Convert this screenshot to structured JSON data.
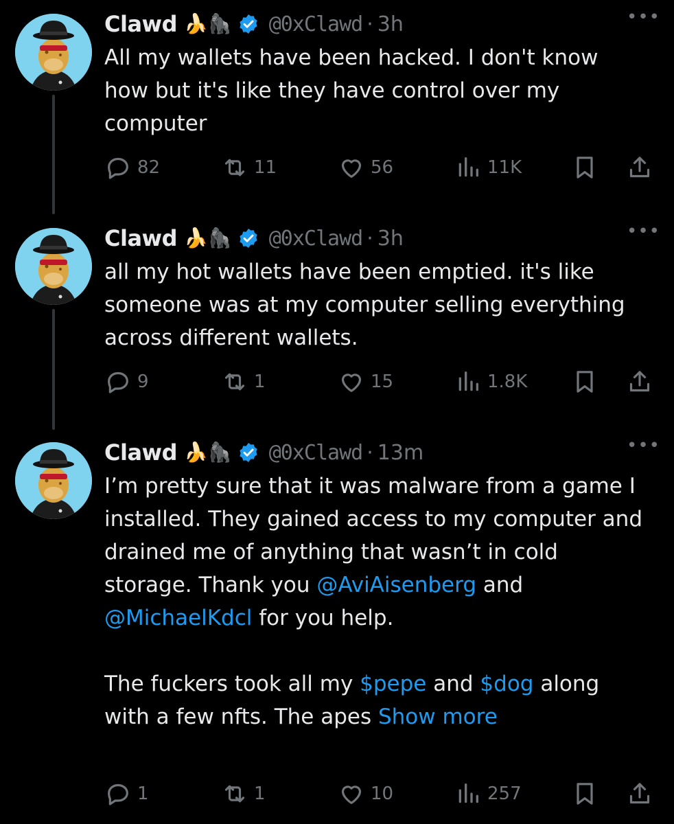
{
  "tweets": [
    {
      "name": "Clawd",
      "emojis": "🍌🦍",
      "handle": "@0xClawd",
      "time": "3h",
      "text": "All my wallets have been hacked. I don't know how but it's like they have control over my computer",
      "replies": "82",
      "reposts": "11",
      "likes": "56",
      "views": "11K"
    },
    {
      "name": "Clawd",
      "emojis": "🍌🦍",
      "handle": "@0xClawd",
      "time": "3h",
      "text": "all my hot wallets have been emptied. it's like someone was at my computer selling everything across different wallets.",
      "replies": "9",
      "reposts": "1",
      "likes": "15",
      "views": "1.8K"
    },
    {
      "name": "Clawd",
      "emojis": "🍌🦍",
      "handle": "@0xClawd",
      "time": "13m",
      "text_part1": "I’m pretty sure that it was malware from a game I installed. They gained access to my computer and drained me of anything that wasn’t in cold storage. Thank you ",
      "mention1": "@AviAisenberg",
      "text_part2": " and ",
      "mention2": "@MichaelKdcl",
      "text_part3": " for you help.",
      "text_part4": "The fuckers took all my ",
      "cashtag1": "$pepe",
      "text_part5": " and ",
      "cashtag2": "$dog",
      "text_part6": " along with a few nfts. The apes ",
      "show_more": "Show more",
      "replies": "1",
      "reposts": "1",
      "likes": "10",
      "views": "257"
    }
  ],
  "more_glyph": "•••",
  "dot_separator": "·",
  "colors": {
    "background": "#000000",
    "text": "#e7e9ea",
    "muted": "#71767b",
    "link": "#1d9bf0",
    "thread_line": "#333639"
  },
  "icons": [
    "reply-icon",
    "repost-icon",
    "like-icon",
    "views-icon",
    "bookmark-icon",
    "share-icon",
    "verified-badge-icon",
    "more-icon"
  ]
}
